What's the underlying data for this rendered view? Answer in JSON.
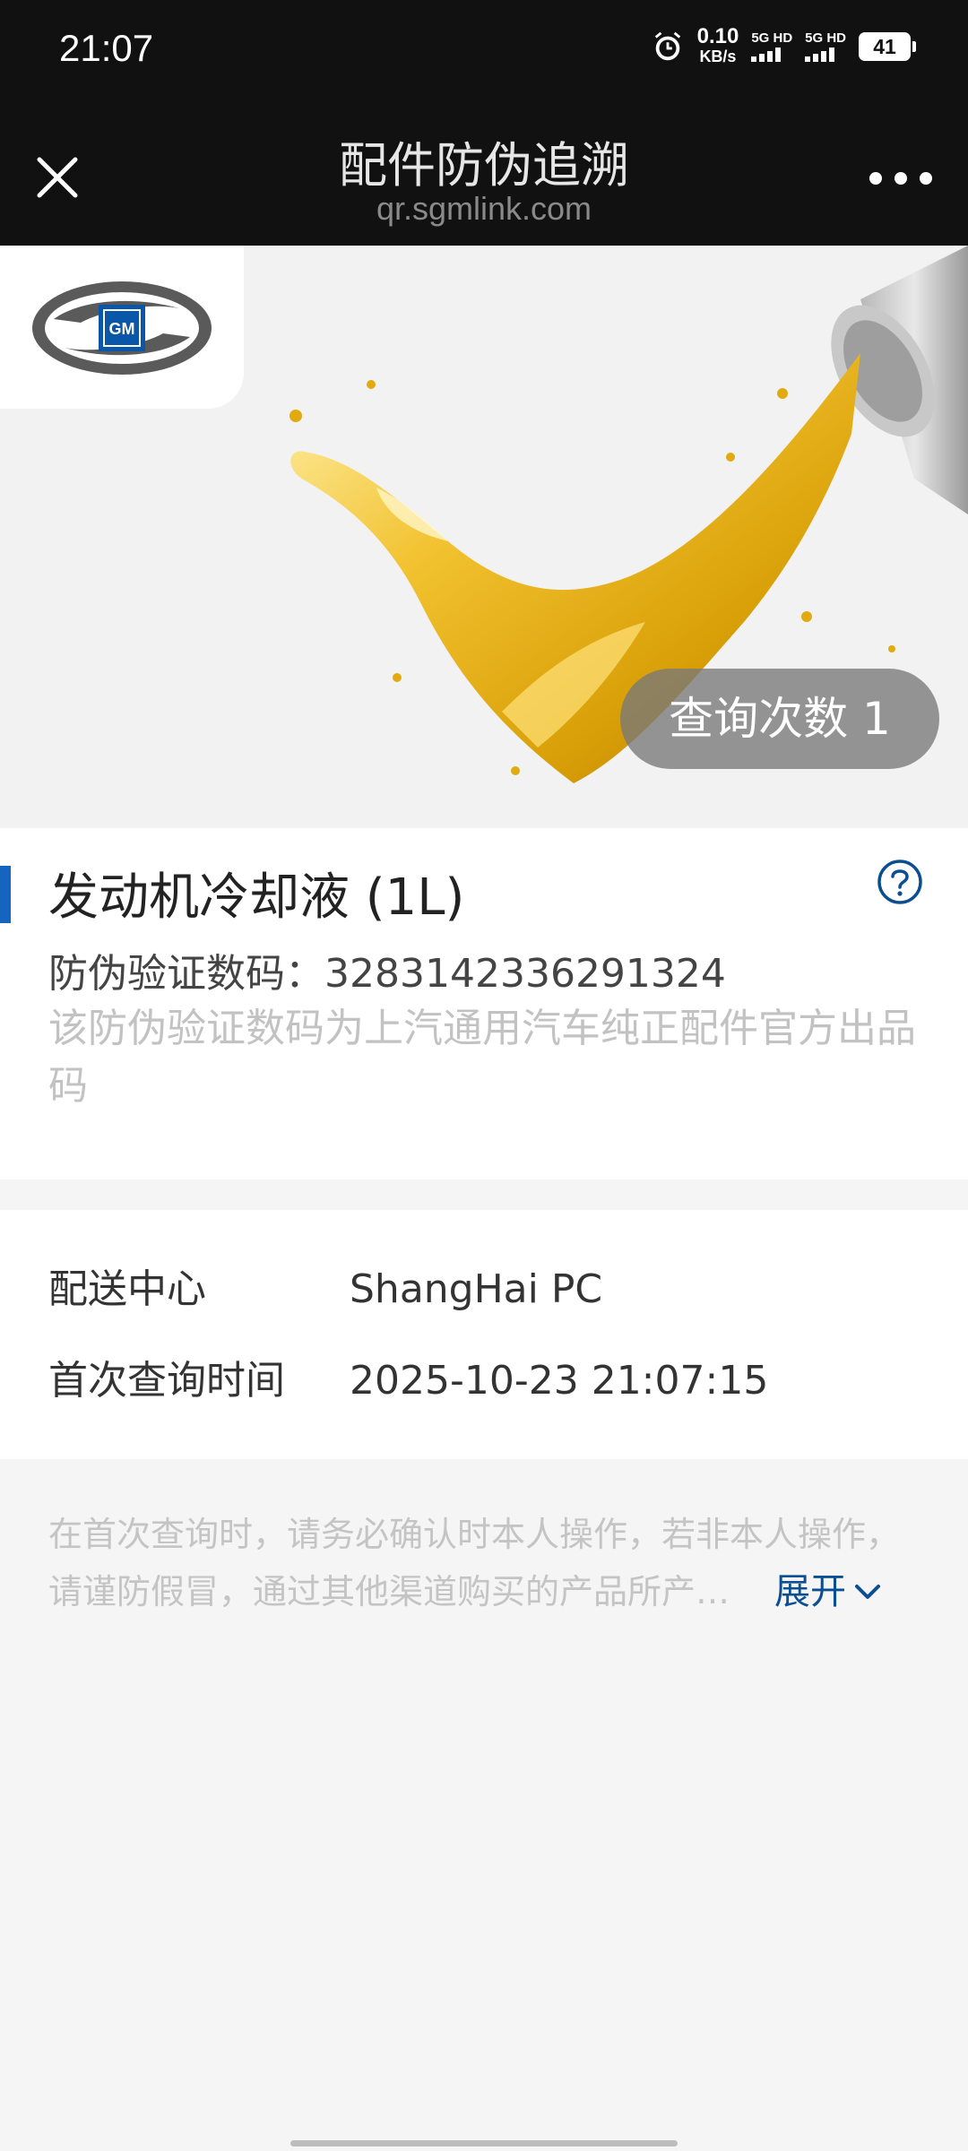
{
  "status_bar": {
    "time": "21:07",
    "net_speed_value": "0.10",
    "net_speed_unit": "KB/s",
    "sim1_label": "5G HD",
    "sim2_label": "5G HD",
    "battery": "41"
  },
  "nav": {
    "title": "配件防伪追溯",
    "subtitle": "qr.sgmlink.com"
  },
  "hero": {
    "logo_text": "GM",
    "query_count_label": "查询次数 1"
  },
  "product": {
    "title": "发动机冷却液 (1L)",
    "code_label": "防伪验证数码：",
    "code_value": "3283142336291324",
    "code_description": "该防伪验证数码为上汽通用汽车纯正配件官方出品码"
  },
  "info": {
    "rows": [
      {
        "label": "配送中心",
        "value": "ShangHai PC"
      },
      {
        "label": "首次查询时间",
        "value": "2025-10-23 21:07:15"
      }
    ]
  },
  "notice": {
    "line1": "在首次查询时，请务必确认时本人操作，若非本人操作，",
    "line2": "请谨防假冒，通过其他渠道购买的产品所产…",
    "expand_label": "展开"
  },
  "colors": {
    "accent": "#1565c0",
    "link": "#0b4f92",
    "header_bg": "#111111"
  },
  "icons": [
    "alarm-icon",
    "close-icon",
    "more-icon",
    "gm-logo",
    "help-icon",
    "chevron-down-icon"
  ]
}
